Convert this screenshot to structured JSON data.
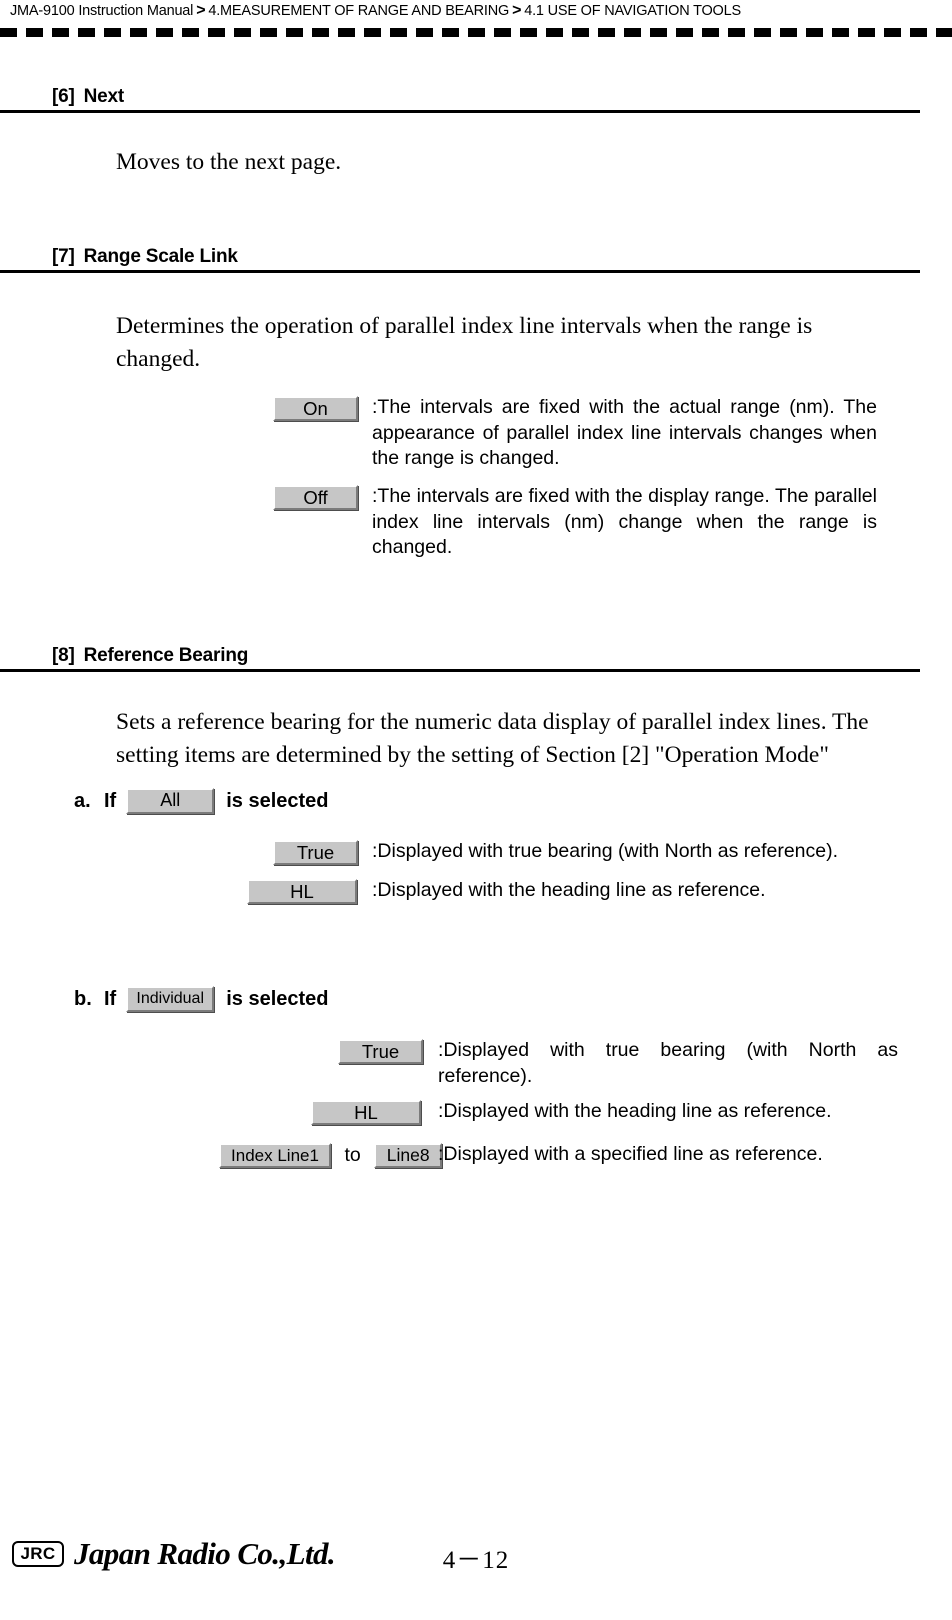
{
  "header": {
    "manual": "JMA-9100 Instruction Manual",
    "separator": ">",
    "chapter": "4.MEASUREMENT OF RANGE AND BEARING",
    "section": "4.1  USE OF NAVIGATION TOOLS"
  },
  "sections": [
    {
      "number": "[6]",
      "title": "Next",
      "body": "Moves to the next page."
    },
    {
      "number": "[7]",
      "title": "Range Scale Link",
      "body": "Determines the operation of parallel index line intervals when the range is changed.",
      "options": [
        {
          "button": "On",
          "text": ":The intervals are fixed with the actual range (nm). The appearance of parallel index line intervals changes when the range is changed."
        },
        {
          "button": "Off",
          "text": ":The intervals are fixed with the display range. The parallel index line intervals (nm) change when the range is changed."
        }
      ]
    },
    {
      "number": "[8]",
      "title": "Reference Bearing",
      "body": "Sets a reference bearing for the numeric data display of parallel index lines. The setting items are determined by the setting of Section [2] \"Operation Mode\"",
      "subsections": [
        {
          "marker": "a.",
          "if_label": "If",
          "button": "All",
          "tail_label": "is selected",
          "options": [
            {
              "button": "True",
              "text": ":Displayed with true bearing (with North as reference)."
            },
            {
              "button": "HL",
              "text": ":Displayed with the heading line as reference."
            }
          ]
        },
        {
          "marker": "b.",
          "if_label": "If",
          "button": "Individual",
          "tail_label": "is selected",
          "options": [
            {
              "button": "True",
              "text": ":Displayed with true bearing (with North as reference)."
            },
            {
              "button": "HL",
              "text": ":Displayed with the heading line as reference."
            },
            {
              "button": "Index Line1",
              "connector": "to",
              "button2": "Line8",
              "text": ":Displayed with a specified line as reference."
            }
          ]
        }
      ]
    }
  ],
  "footer": {
    "logo_mark": "JRC",
    "company": "Japan Radio Co.,Ltd.",
    "page_number": "4－12"
  }
}
